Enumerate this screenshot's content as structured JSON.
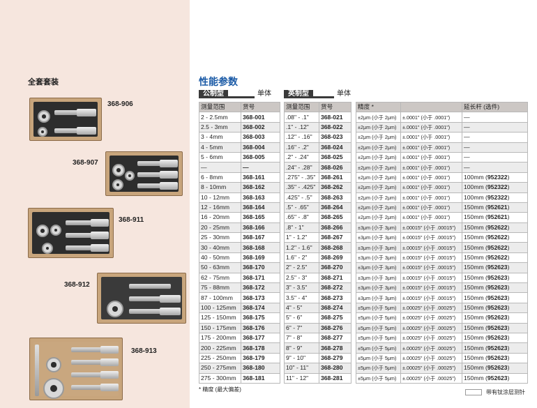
{
  "left": {
    "title": "全套套装",
    "kits": [
      {
        "label": "368-906"
      },
      {
        "label": "368-907"
      },
      {
        "label": "368-911"
      },
      {
        "label": "368-912"
      },
      {
        "label": "368-913"
      }
    ]
  },
  "heading": "性能参数",
  "tabs": {
    "metric": "公制型",
    "metric_note": "单体",
    "inch": "英制型",
    "inch_note": "单体"
  },
  "metric_table": {
    "headers": [
      "测量范围",
      "货号"
    ],
    "rows": [
      [
        "2 - 2.5mm",
        "368-001"
      ],
      [
        "2.5 - 3mm",
        "368-002"
      ],
      [
        "3 - 4mm",
        "368-003"
      ],
      [
        "4 - 5mm",
        "368-004"
      ],
      [
        "5 - 6mm",
        "368-005"
      ],
      [
        "—",
        "—"
      ],
      [
        "6 - 8mm",
        "368-161"
      ],
      [
        "8 - 10mm",
        "368-162"
      ],
      [
        "10 - 12mm",
        "368-163"
      ],
      [
        "12 - 16mm",
        "368-164"
      ],
      [
        "16 - 20mm",
        "368-165"
      ],
      [
        "20 - 25mm",
        "368-166"
      ],
      [
        "25 - 30mm",
        "368-167"
      ],
      [
        "30 - 40mm",
        "368-168"
      ],
      [
        "40 - 50mm",
        "368-169"
      ],
      [
        "50 - 63mm",
        "368-170"
      ],
      [
        "62 - 75mm",
        "368-171"
      ],
      [
        "75 - 88mm",
        "368-172"
      ],
      [
        "87 - 100mm",
        "368-173"
      ],
      [
        "100 - 125mm",
        "368-174"
      ],
      [
        "125 - 150mm",
        "368-175"
      ],
      [
        "150 - 175mm",
        "368-176"
      ],
      [
        "175 - 200mm",
        "368-177"
      ],
      [
        "200 - 225mm",
        "368-178"
      ],
      [
        "225 - 250mm",
        "368-179"
      ],
      [
        "250 - 275mm",
        "368-180"
      ],
      [
        "275 - 300mm",
        "368-181"
      ]
    ]
  },
  "inch_table": {
    "headers": [
      "测量范围",
      "货号"
    ],
    "rows": [
      [
        ".08\" - .1\"",
        "368-021"
      ],
      [
        ".1\" - .12\"",
        "368-022"
      ],
      [
        ".12\" - .16\"",
        "368-023"
      ],
      [
        ".16\" - .2\"",
        "368-024"
      ],
      [
        ".2\" - .24\"",
        "368-025"
      ],
      [
        ".24\" - .28\"",
        "368-026"
      ],
      [
        ".275\" - .35\"",
        "368-261"
      ],
      [
        ".35\" - .425\"",
        "368-262"
      ],
      [
        ".425\" - .5\"",
        "368-263"
      ],
      [
        ".5\" - .65\"",
        "368-264"
      ],
      [
        ".65\" - .8\"",
        "368-265"
      ],
      [
        ".8\" - 1\"",
        "368-266"
      ],
      [
        "1\" - 1.2\"",
        "368-267"
      ],
      [
        "1.2\" - 1.6\"",
        "368-268"
      ],
      [
        "1.6\" - 2\"",
        "368-269"
      ],
      [
        "2\" - 2.5\"",
        "368-270"
      ],
      [
        "2.5\" - 3\"",
        "368-271"
      ],
      [
        "3\" - 3.5\"",
        "368-272"
      ],
      [
        "3.5\" - 4\"",
        "368-273"
      ],
      [
        "4\" - 5\"",
        "368-274"
      ],
      [
        "5\" - 6\"",
        "368-275"
      ],
      [
        "6\" - 7\"",
        "368-276"
      ],
      [
        "7\" - 8\"",
        "368-277"
      ],
      [
        "8\" - 9\"",
        "368-278"
      ],
      [
        "9\" - 10\"",
        "368-279"
      ],
      [
        "10\" - 11\"",
        "368-280"
      ],
      [
        "11\" - 12\"",
        "368-281"
      ]
    ]
  },
  "accuracy_table": {
    "headers": [
      "精度 *",
      "",
      "延长杆 (选件)"
    ],
    "rows": [
      [
        "±2μm (小于 2μm)",
        "±.0001\" (小于 .0001\")",
        "—",
        ""
      ],
      [
        "±2μm (小于 2μm)",
        "±.0001\" (小于 .0001\")",
        "—",
        ""
      ],
      [
        "±2μm (小于 2μm)",
        "±.0001\" (小于 .0001\")",
        "—",
        ""
      ],
      [
        "±2μm (小于 2μm)",
        "±.0001\" (小于 .0001\")",
        "—",
        ""
      ],
      [
        "±2μm (小于 2μm)",
        "±.0001\" (小于 .0001\")",
        "—",
        ""
      ],
      [
        "±2μm (小于 2μm)",
        "±.0001\" (小于 .0001\")",
        "—",
        ""
      ],
      [
        "±2μm (小于 2μm)",
        "±.0001\" (小于 .0001\")",
        "100mm (",
        "952322"
      ],
      [
        "±2μm (小于 2μm)",
        "±.0001\" (小于 .0001\")",
        "100mm (",
        "952322"
      ],
      [
        "±2μm (小于 2μm)",
        "±.0001\" (小于 .0001\")",
        "100mm (",
        "952322"
      ],
      [
        "±2μm (小于 2μm)",
        "±.0001\" (小于 .0001\")",
        "150mm (",
        "952621"
      ],
      [
        "±2μm (小于 2μm)",
        "±.0001\" (小于 .0001\")",
        "150mm (",
        "952621"
      ],
      [
        "±3μm (小于 3μm)",
        "±.00015\" (小于 .00015\")",
        "150mm (",
        "952622"
      ],
      [
        "±3μm (小于 3μm)",
        "±.00015\" (小于 .00015\")",
        "150mm (",
        "952622"
      ],
      [
        "±3μm (小于 3μm)",
        "±.00015\" (小于 .00015\")",
        "150mm (",
        "952622"
      ],
      [
        "±3μm (小于 3μm)",
        "±.00015\" (小于 .00015\")",
        "150mm (",
        "952622"
      ],
      [
        "±3μm (小于 3μm)",
        "±.00015\" (小于 .00015\")",
        "150mm (",
        "952623"
      ],
      [
        "±3μm (小于 3μm)",
        "±.00015\" (小于 .00015\")",
        "150mm (",
        "952623"
      ],
      [
        "±3μm (小于 3μm)",
        "±.00015\" (小于 .00015\")",
        "150mm (",
        "952623"
      ],
      [
        "±3μm (小于 3μm)",
        "±.00015\" (小于 .00015\")",
        "150mm (",
        "952623"
      ],
      [
        "±5μm (小于 5μm)",
        "±.00025\" (小于 .00025\")",
        "150mm (",
        "952623"
      ],
      [
        "±5μm (小于 5μm)",
        "±.00025\" (小于 .00025\")",
        "150mm (",
        "952623"
      ],
      [
        "±5μm (小于 5μm)",
        "±.00025\" (小于 .00025\")",
        "150mm (",
        "952623"
      ],
      [
        "±5μm (小于 5μm)",
        "±.00025\" (小于 .00025\")",
        "150mm (",
        "952623"
      ],
      [
        "±5μm (小于 5μm)",
        "±.00025\" (小于 .00025\")",
        "150mm (",
        "952623"
      ],
      [
        "±5μm (小于 5μm)",
        "±.00025\" (小于 .00025\")",
        "150mm (",
        "952623"
      ],
      [
        "±5μm (小于 5μm)",
        "±.00025\" (小于 .00025\")",
        "150mm (",
        "952623"
      ],
      [
        "±5μm (小于 5μm)",
        "±.00025\" (小于 .00025\")",
        "150mm (",
        "952623"
      ]
    ]
  },
  "footnote": "* 精度 (最大偏差)",
  "legend": "带有钛涂层测针",
  "colors": {
    "heading": "#1a5aa6",
    "left_panel": "#f6e6de",
    "header_row": "#ccc7c4"
  }
}
